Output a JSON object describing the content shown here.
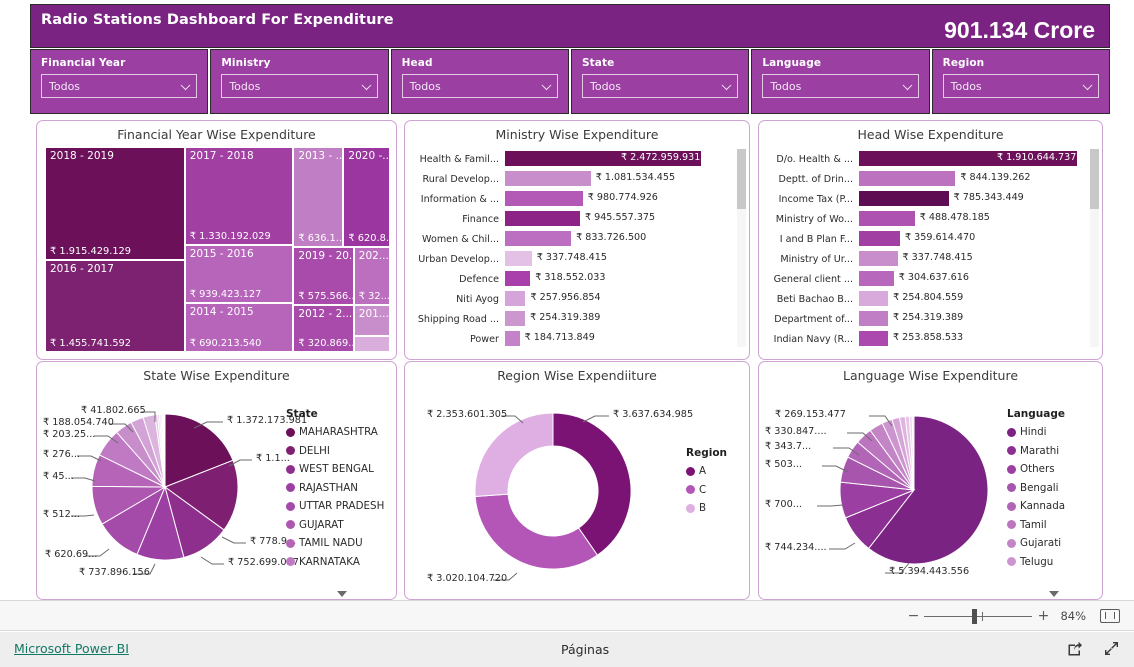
{
  "header": {
    "title": "Radio Stations Dashboard For Expenditure",
    "kpi_value": "901.134 Crore",
    "bg_color": "#7b2382"
  },
  "slicers": [
    {
      "label": "Financial Year",
      "value": "Todos",
      "icon": "chevron-down-icon"
    },
    {
      "label": "Ministry",
      "value": "Todos",
      "icon": "chevron-down-icon"
    },
    {
      "label": "Head",
      "value": "Todos",
      "icon": "chevron-down-icon"
    },
    {
      "label": "State",
      "value": "Todos",
      "icon": "chevron-down-icon"
    },
    {
      "label": "Language",
      "value": "Todos",
      "icon": "chevron-down-icon"
    },
    {
      "label": "Region",
      "value": "Todos",
      "icon": "chevron-down-icon"
    }
  ],
  "palette": {
    "darkest": "#6b1059",
    "dark": "#7b2382",
    "mid_dark": "#8e2f8d",
    "mid": "#a44aa8",
    "light": "#bf7ac3",
    "lighter": "#d3a2d6",
    "lightest": "#e8cdea",
    "pale": "#f3e5f4"
  },
  "chart_data": [
    {
      "id": "financial-year-treemap",
      "type": "treemap",
      "title": "Financial Year Wise Expenditure",
      "categories": [
        "2018 - 2019",
        "2016 - 2017",
        "2017 - 2018",
        "2015 - 2016",
        "2014 - 2015",
        "2013 - ...",
        "2019 - 20...",
        "2012 - 2...",
        "2020 -...",
        "202...",
        "201..."
      ],
      "labels": [
        "₹ 1.915.429.129",
        "₹ 1.455.741.592",
        "₹ 1.330.192.029",
        "₹ 939.423.127",
        "₹ 690.213.540",
        "₹ 636.1...",
        "₹ 575.566....",
        "₹ 320.869....",
        "₹ 620.8...",
        "₹ 32...",
        ""
      ],
      "values": [
        1915429129,
        1455741592,
        1330192029,
        939423127,
        690213540,
        636100000,
        575566000,
        320869000,
        620800000,
        320000000,
        120000000
      ]
    },
    {
      "id": "ministry-bar",
      "type": "bar",
      "title": "Ministry Wise Expenditure",
      "orientation": "horizontal",
      "categories": [
        "Health & Famil...",
        "Rural Develop...",
        "Information & ...",
        "Finance",
        "Women & Chil...",
        "Urban Develop...",
        "Defence",
        "Niti Ayog",
        "Shipping Road ...",
        "Power"
      ],
      "labels": [
        "₹ 2.472.959.931",
        "₹ 1.081.534.455",
        "₹ 980.774.926",
        "₹ 945.557.375",
        "₹ 833.726.500",
        "₹ 337.748.415",
        "₹ 318.552.033",
        "₹ 257.956.854",
        "₹ 254.319.389",
        "₹ 184.713.849"
      ],
      "values": [
        2472959931,
        1081534455,
        980774926,
        945557375,
        833726500,
        337748415,
        318552033,
        257956854,
        254319389,
        184713849
      ],
      "xmax": 2472959931,
      "has_scrollbar": true
    },
    {
      "id": "head-bar",
      "type": "bar",
      "title": "Head Wise Expenditure",
      "orientation": "horizontal",
      "categories": [
        "D/o. Health & ...",
        "Deptt. of Drin...",
        "Income Tax (P...",
        "Ministry of Wo...",
        "I and B Plan F...",
        "Ministry of Ur...",
        "General client ...",
        "Beti Bachao B...",
        "Department of...",
        "Indian Navy (R..."
      ],
      "labels": [
        "₹ 1.910.644.737",
        "₹ 844.139.262",
        "₹ 785.343.449",
        "₹ 488.478.185",
        "₹ 359.614.470",
        "₹ 337.748.415",
        "₹ 304.637.616",
        "₹ 254.804.559",
        "₹ 254.319.389",
        "₹ 253.858.533"
      ],
      "values": [
        1910644737,
        844139262,
        785343449,
        488478185,
        359614470,
        337748415,
        304637616,
        254804559,
        254319389,
        253858533
      ],
      "xmax": 1910644737,
      "has_scrollbar": true
    },
    {
      "id": "state-pie",
      "type": "pie",
      "title": "State Wise Expenditure",
      "legend_title": "State",
      "legend_position": "right",
      "legend_has_more": true,
      "categories": [
        "MAHARASHTRA",
        "DELHI",
        "WEST BENGAL",
        "RAJASTHAN",
        "UTTAR PRADESH",
        "GUJARAT",
        "TAMIL NADU",
        "KARNATAKA"
      ],
      "callouts": [
        "₹ 1.372.173.981",
        "₹ 1.1...",
        "₹ 778.9...",
        "₹ 752.699.037",
        "₹ 737.896.156",
        "₹ 620.69...",
        "₹ 512...",
        "₹ 45...",
        "₹ 276...",
        "₹ 203.25...",
        "₹ 188.054.740",
        "₹ 41.802.665"
      ],
      "values": [
        1372173981,
        1150000000,
        778900000,
        752699037,
        737896156,
        620690000,
        512000000,
        450000000,
        276000000,
        203250000,
        188054740,
        41802665
      ]
    },
    {
      "id": "region-donut",
      "type": "pie",
      "subtype": "donut",
      "title": "Region Wise Expendiiture",
      "legend_title": "Region",
      "legend_position": "right",
      "categories": [
        "A",
        "C",
        "B"
      ],
      "labels": [
        "₹ 3.637.634.985",
        "₹ 3.020.104.720",
        "₹ 2.353.601.305"
      ],
      "values": [
        3637634985,
        3020104720,
        2353601305
      ]
    },
    {
      "id": "language-pie",
      "type": "pie",
      "title": "Language Wise Expenditure",
      "legend_title": "Language",
      "legend_position": "right",
      "legend_has_more": true,
      "categories": [
        "Hindi",
        "Marathi",
        "Others",
        "Bengali",
        "Kannada",
        "Tamil",
        "Gujarati",
        "Telugu"
      ],
      "callouts": [
        "₹ 5.394.443.556",
        "₹ 744.234....",
        "₹ 700...",
        "₹ 503...",
        "₹ 343.7...",
        "₹ 330.847....",
        "₹ 269.153.477"
      ],
      "values": [
        5394443556,
        744234000,
        700000000,
        503000000,
        343700000,
        330847000,
        269153477
      ]
    }
  ],
  "statusbar": {
    "zoom_out_label": "−",
    "zoom_in_label": "+",
    "zoom_level": "84%",
    "fit_icon": "fit-to-page-icon"
  },
  "footer": {
    "brand_link": "Microsoft Power BI",
    "pages_label": "Páginas",
    "share_icon": "share-icon",
    "fullscreen_icon": "fullscreen-icon"
  }
}
